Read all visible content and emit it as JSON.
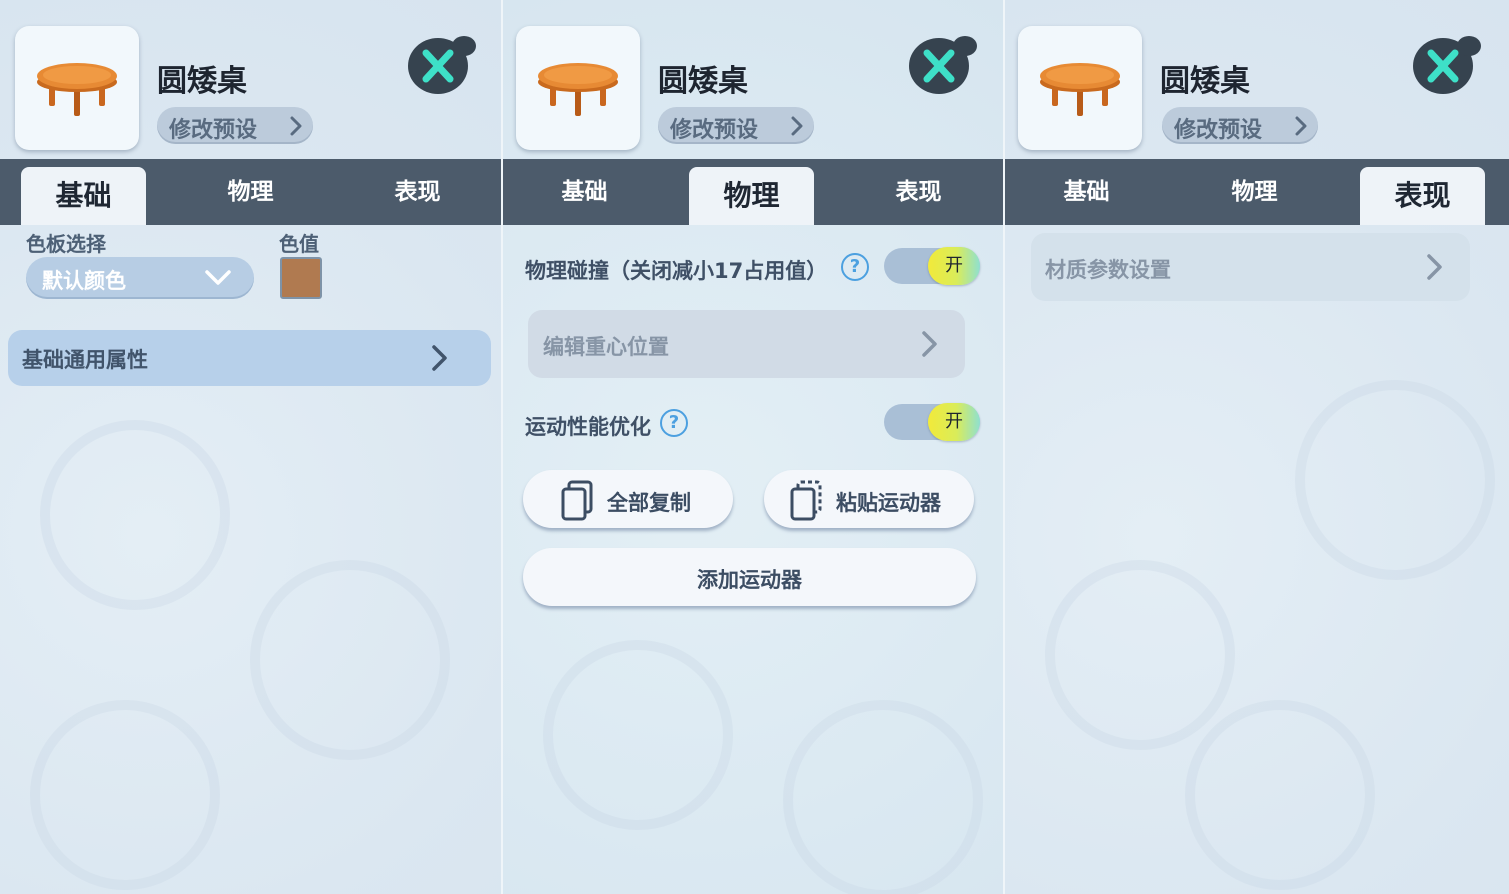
{
  "item": {
    "name": "圆矮桌",
    "preset_label": "修改预设"
  },
  "tabs": [
    "基础",
    "物理",
    "表现"
  ],
  "panels": [
    {
      "active_tab": "基础"
    },
    {
      "active_tab": "物理"
    },
    {
      "active_tab": "表现"
    }
  ],
  "basic": {
    "palette_label": "色板选择",
    "color_value_label": "色值",
    "palette_selected": "默认颜色",
    "color_swatch": "#b07a50",
    "general_props_label": "基础通用属性"
  },
  "physics": {
    "collision_label": "物理碰撞（关闭减小17占用值）",
    "collision_toggle": "开",
    "edit_center_label": "编辑重心位置",
    "motion_opt_label": "运动性能优化",
    "motion_opt_toggle": "开",
    "copy_all_label": "全部复制",
    "paste_mover_label": "粘贴运动器",
    "add_mover_label": "添加运动器"
  },
  "appearance": {
    "material_settings_label": "材质参数设置"
  },
  "icons": {
    "help": "?",
    "close": "close-icon",
    "chevron": "chevron-right-icon"
  },
  "colors": {
    "tab_bar": "#4c5b6b",
    "active_tab": "#eef3f8",
    "close_x": "#3ee0c8",
    "toggle_knob": "#f2ea3a"
  }
}
